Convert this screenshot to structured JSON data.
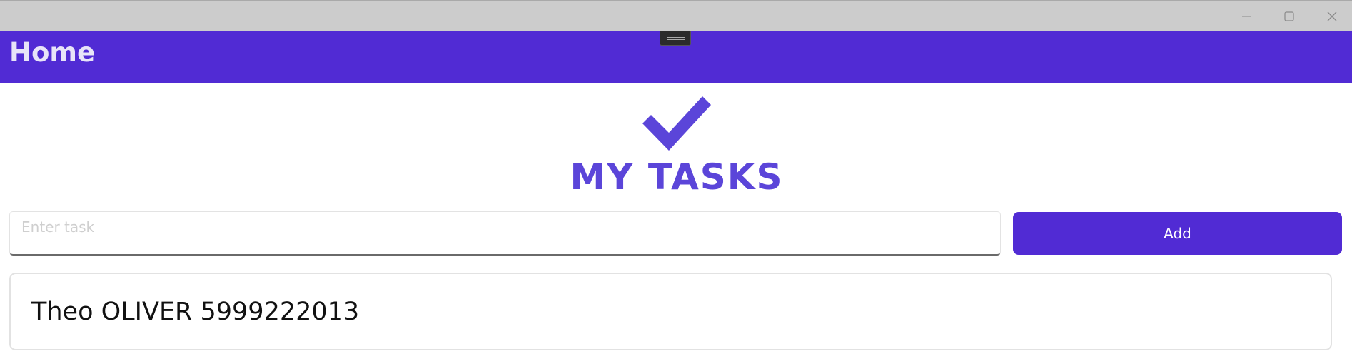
{
  "window": {
    "controls": {
      "minimize_icon": "minimize-icon",
      "maximize_icon": "maximize-icon",
      "close_icon": "close-icon"
    }
  },
  "header": {
    "title": "Home",
    "background_color": "#512bd4"
  },
  "logo": {
    "icon": "checkmark-icon",
    "text": "MY TASKS",
    "color": "#5b45d9"
  },
  "task_form": {
    "input": {
      "placeholder": "Enter task",
      "value": ""
    },
    "add_button_label": "Add"
  },
  "tasks": [
    {
      "text": "Theo OLIVER 5999222013"
    }
  ]
}
